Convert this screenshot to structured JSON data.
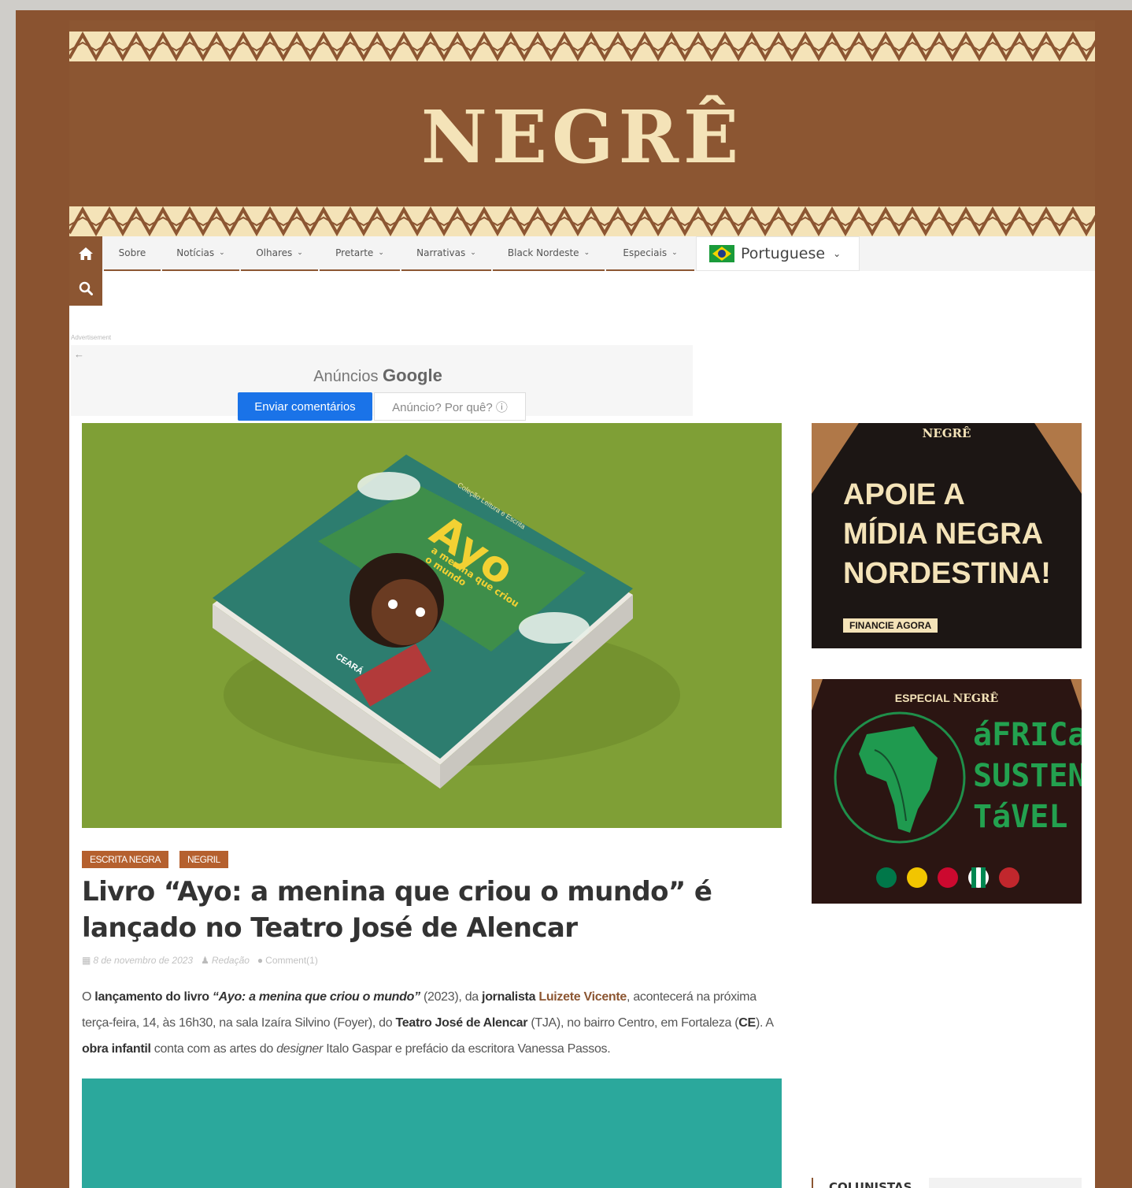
{
  "site": {
    "logo": "NEGRÊ"
  },
  "nav": {
    "items": [
      {
        "label": "Sobre",
        "chevron": false
      },
      {
        "label": "Notícias",
        "chevron": true
      },
      {
        "label": "Olhares",
        "chevron": true
      },
      {
        "label": "Pretarte",
        "chevron": true
      },
      {
        "label": "Narrativas",
        "chevron": true
      },
      {
        "label": "Black Nordeste",
        "chevron": true
      },
      {
        "label": "Especiais",
        "chevron": true
      }
    ],
    "language": "Portuguese",
    "icons": [
      "home-icon",
      "search-icon",
      "chevron-down-icon"
    ]
  },
  "ad": {
    "label": "Advertisement",
    "title_prefix": "Anúncios",
    "title_brand": "Google",
    "feedback_button": "Enviar comentários",
    "why_button": "Anúncio? Por quê? ⓘ"
  },
  "hero_image": {
    "book_series": "Coleção Leitura e Escrita",
    "book_title": "Ayo",
    "book_subtitle": "a menina que criou o mundo",
    "book_publisher": "CEARÁ",
    "colors": {
      "background": "#7f9f36"
    }
  },
  "article": {
    "tags": [
      "ESCRITA NEGRA",
      "NEGRIL"
    ],
    "title": "Livro “Ayo: a menina que criou o mundo” é lançado no Teatro José de Alencar",
    "date": "8 de novembro de 2023",
    "author": "Redação",
    "comments": "Comment(1)",
    "body": {
      "p1": "O ",
      "b1": "lançamento do livro",
      "p2": " ",
      "i1": "“Ayo: a menina que criou o mundo”",
      "p3": " (2023), da ",
      "b2": "jornalista",
      "p4": " ",
      "l1": "Luizete Vicente",
      "p5": ", acontecerá na próxima terça-feira, 14, às 16h30, na sala Izaíra Silvino (Foyer), do ",
      "b3": "Teatro José de Alencar",
      "p6": " (TJA), no bairro Centro, em Fortaleza (",
      "b4": "CE",
      "p7": "). A ",
      "b5": "obra infantil",
      "p8": " conta com as artes do ",
      "i2": "designer",
      "p9": " Italo Gaspar e prefácio da escritora Vanessa Passos."
    }
  },
  "sidebar": {
    "banner1": {
      "brand": "NEGRÊ",
      "line1": "APOIE A",
      "line2": "MÍDIA NEGRA",
      "line3": "NORDESTINA!",
      "cta": "FINANCIE AGORA"
    },
    "banner2": {
      "label": "ESPECIAL",
      "brand": "NEGRÊ",
      "line1": "áFRICa",
      "line2": "SUSTEN",
      "line3": "TáVEL"
    },
    "section_title": "COLUNISTAS"
  },
  "colors": {
    "brand_brown": "#8c5632",
    "logo_cream": "#f4e3b8",
    "tag": "#b5602e",
    "google_blue": "#1a73e8"
  }
}
